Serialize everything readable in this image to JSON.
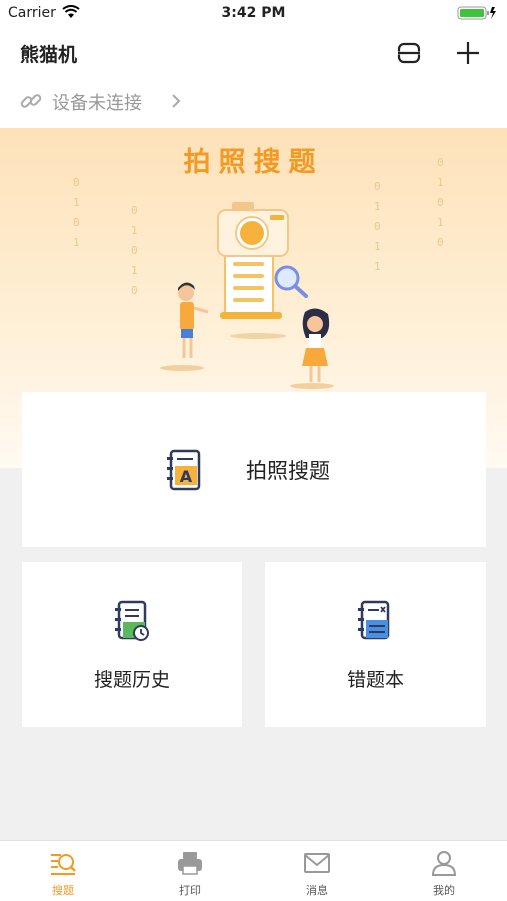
{
  "status_bar": {
    "carrier": "Carrier",
    "time": "3:42 PM"
  },
  "nav": {
    "title": "熊猫机",
    "scan_icon": "scan-icon",
    "add_icon": "plus-icon"
  },
  "device": {
    "status_text": "设备未连接",
    "icon": "link-icon"
  },
  "banner": {
    "heading": "拍照搜题"
  },
  "cards": {
    "main": {
      "label": "拍照搜题",
      "icon": "book-a-icon"
    },
    "history": {
      "label": "搜题历史",
      "icon": "history-notebook-icon"
    },
    "wrong": {
      "label": "错题本",
      "icon": "wrong-notebook-icon"
    }
  },
  "tabbar": {
    "tabs": [
      {
        "label": "搜题",
        "active": true
      },
      {
        "label": "打印",
        "active": false
      },
      {
        "label": "消息",
        "active": false
      },
      {
        "label": "我的",
        "active": false
      }
    ]
  },
  "colors": {
    "accent": "#f29a22",
    "background": "#f0f0f0"
  }
}
